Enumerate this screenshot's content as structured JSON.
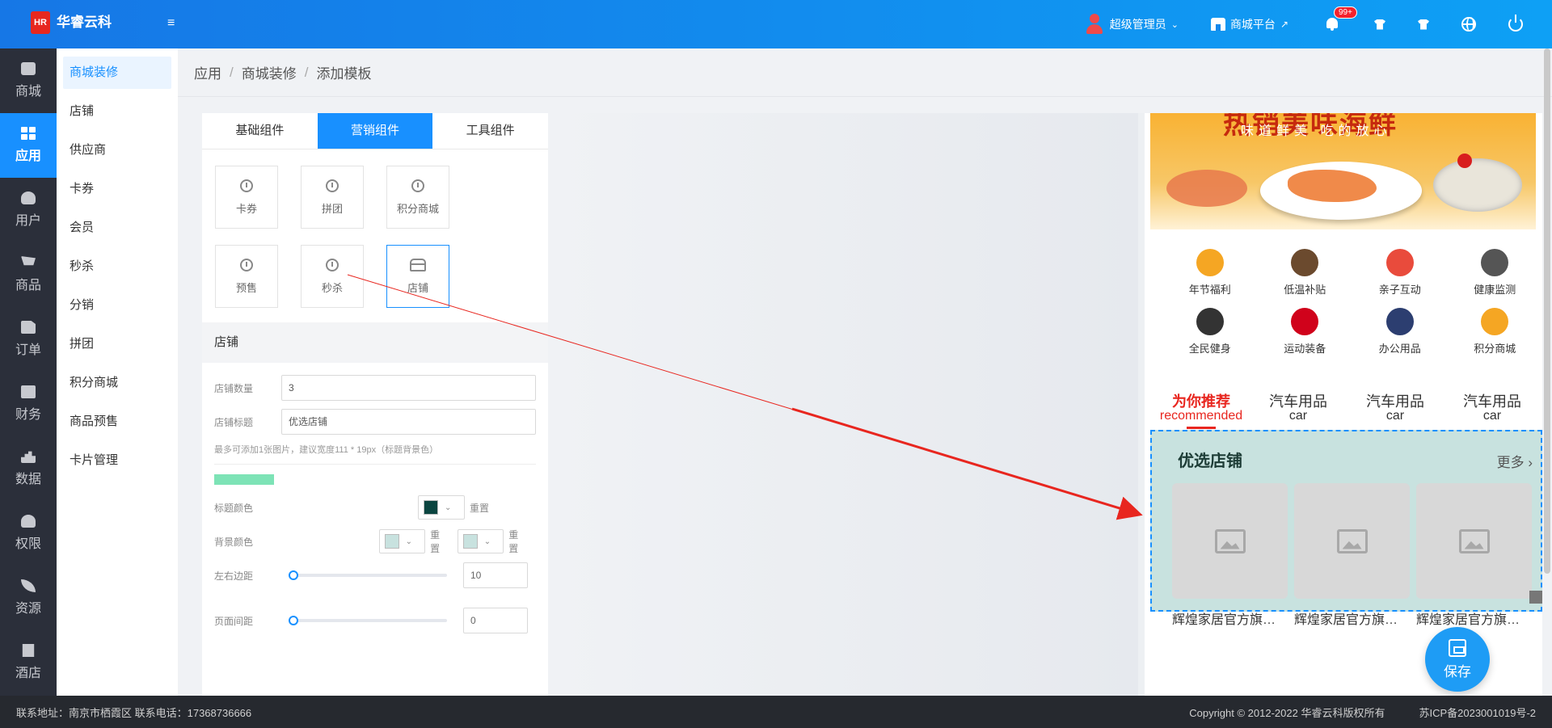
{
  "header": {
    "logo_mark": "HR",
    "brand_name": "华睿云科",
    "user_name": "超级管理员",
    "mall_platform": "商城平台",
    "notification_badge": "99+"
  },
  "nav": {
    "items": [
      {
        "label": "商城",
        "icon": "bag-icon"
      },
      {
        "label": "应用",
        "icon": "apps-grid-icon"
      },
      {
        "label": "用户",
        "icon": "user-icon"
      },
      {
        "label": "商品",
        "icon": "cart-icon"
      },
      {
        "label": "订单",
        "icon": "document-icon"
      },
      {
        "label": "财务",
        "icon": "yen-icon"
      },
      {
        "label": "数据",
        "icon": "chart-icon"
      },
      {
        "label": "权限",
        "icon": "permission-icon"
      },
      {
        "label": "资源",
        "icon": "leaf-icon"
      },
      {
        "label": "酒店",
        "icon": "hotel-icon"
      }
    ],
    "active": "应用"
  },
  "subnav": {
    "items": [
      "商城装修",
      "店铺",
      "供应商",
      "卡券",
      "会员",
      "秒杀",
      "分销",
      "拼团",
      "积分商城",
      "商品预售",
      "卡片管理"
    ],
    "active": "商城装修"
  },
  "breadcrumb": [
    "应用",
    "商城装修",
    "添加模板"
  ],
  "panel": {
    "tabs": [
      "基础组件",
      "营销组件",
      "工具组件"
    ],
    "active_tab": "营销组件",
    "components": [
      "卡券",
      "拼团",
      "积分商城",
      "预售",
      "秒杀",
      "店铺"
    ],
    "selected_component": "店铺",
    "section_title": "店铺",
    "form": {
      "shop_count_label": "店铺数量",
      "shop_count_value": "3",
      "shop_title_label": "店铺标题",
      "shop_title_value": "优选店铺",
      "hint": "最多可添加1张图片，建议宽度111 * 19px（标题背景色）",
      "title_color_label": "标题颜色",
      "bg_color_label": "背景颜色",
      "reset_label": "重置",
      "margin_lr_label": "左右边距",
      "margin_lr_value": "10",
      "page_gap_label": "页面间距",
      "page_gap_value": "0"
    },
    "colors": {
      "title_color": "#0b4540",
      "bg_color_1": "#c8e2df",
      "bg_color_2": "#c8e2df",
      "title_bg_bar": "#7de3b6"
    }
  },
  "preview": {
    "banner_title": "热销美味海鲜",
    "banner_sub": "味道鲜美 吃的放心",
    "icons": [
      {
        "label": "年节福利",
        "color": "#f5a623"
      },
      {
        "label": "低温补贴",
        "color": "#6b4a2e"
      },
      {
        "label": "亲子互动",
        "color": "#e94b3c"
      },
      {
        "label": "健康监测",
        "color": "#555555"
      },
      {
        "label": "全民健身",
        "color": "#333333"
      },
      {
        "label": "运动装备",
        "color": "#d0021b"
      },
      {
        "label": "办公用品",
        "color": "#2c3e70"
      },
      {
        "label": "积分商城",
        "color": "#f5a623"
      }
    ],
    "tabs": [
      {
        "cn": "为你推荐",
        "en": "recommended"
      },
      {
        "cn": "汽车用品",
        "en": "car"
      },
      {
        "cn": "汽车用品",
        "en": "car"
      },
      {
        "cn": "汽车用品",
        "en": "car"
      }
    ],
    "shop_section": {
      "title": "优选店铺",
      "more": "更多",
      "cards": [
        "辉煌家居官方旗舰店",
        "辉煌家居官方旗舰店",
        "辉煌家居官方旗舰店"
      ]
    }
  },
  "save_label": "保存",
  "footer": {
    "address": "联系地址：南京市栖霞区 联系电话：17368736666",
    "copyright": "Copyright © 2012-2022 华睿云科版权所有",
    "icp": "苏ICP备2023001019号-2"
  }
}
